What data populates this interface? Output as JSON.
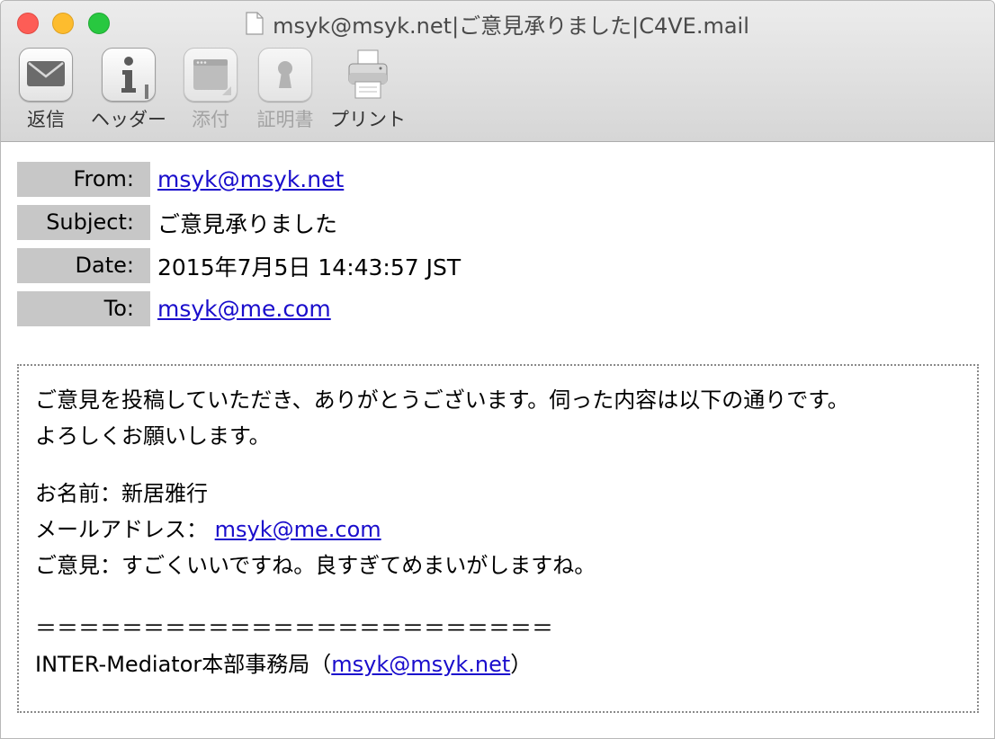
{
  "window": {
    "title": "msyk@msyk.net|ご意見承りました|C4VE.mail"
  },
  "toolbar": {
    "reply_label": "返信",
    "header_label": "ヘッダー",
    "attachment_label": "添付",
    "certificate_label": "証明書",
    "print_label": "プリント"
  },
  "headers": {
    "from_label": "From:",
    "from_value": "msyk@msyk.net",
    "subject_label": "Subject:",
    "subject_value": "ご意見承りました",
    "date_label": "Date:",
    "date_value": "2015年7月5日 14:43:57 JST",
    "to_label": "To:",
    "to_value": "msyk@me.com"
  },
  "body": {
    "line1": "ご意見を投稿していただき、ありがとうございます。伺った内容は以下の通りです。",
    "line2": "よろしくお願いします。",
    "name_line": "お名前：新居雅行",
    "email_prefix": "メールアドレス：",
    "email_link": "msyk@me.com",
    "opinion_line": "ご意見：すごくいいですね。良すぎてめまいがしますね。",
    "separator": "＝＝＝＝＝＝＝＝＝＝＝＝＝＝＝＝＝＝＝＝＝＝＝＝",
    "signature_prefix": "INTER-Mediator本部事務局（",
    "signature_link": "msyk@msyk.net",
    "signature_suffix": "）"
  },
  "colors": {
    "link": "#1a0dcc",
    "header_label_bg": "#c7c7c7",
    "close": "#fd5d56",
    "minimize": "#fdbc2e",
    "maximize": "#28c840"
  }
}
